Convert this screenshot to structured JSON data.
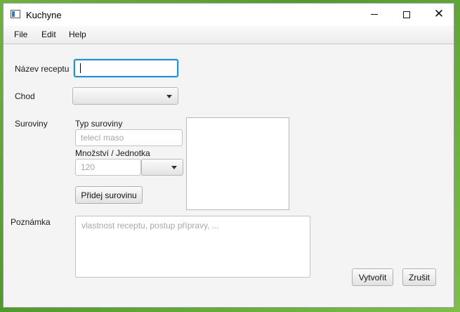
{
  "window": {
    "title": "Kuchyne"
  },
  "menu": {
    "file": "File",
    "edit": "Edit",
    "help": "Help"
  },
  "form": {
    "recipe_name_label": "Název receptu",
    "recipe_name_value": "",
    "course_label": "Chod",
    "course_value": "",
    "ingredients_label": "Suroviny",
    "ingredient_type_label": "Typ suroviny",
    "ingredient_type_placeholder": "telecí maso",
    "amount_unit_label": "Množství / Jednotka",
    "amount_placeholder": "120",
    "unit_value": "",
    "add_ingredient_button": "Přidej surovinu",
    "note_label": "Poznámka",
    "note_placeholder": "vlastnost receptu, postup přípravy, ...",
    "create_button": "Vytvořit",
    "cancel_button": "Zrušit"
  },
  "colors": {
    "focus": "#2a8fd0",
    "window_bg": "#f4f4f4"
  }
}
